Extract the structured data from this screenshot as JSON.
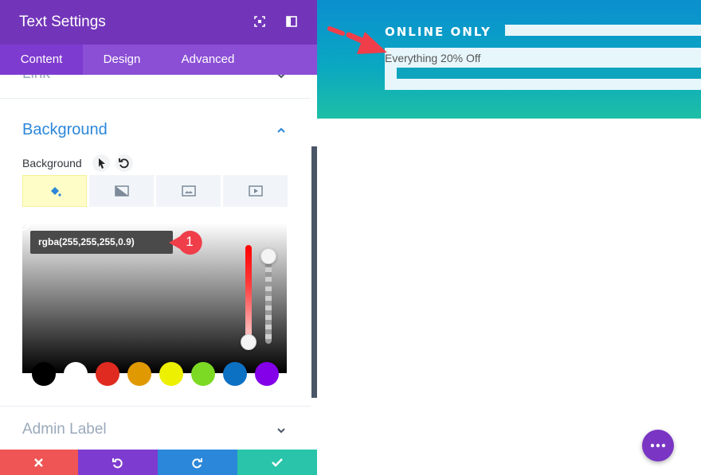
{
  "panel": {
    "title": "Text Settings",
    "header_icons": [
      "expand-icon",
      "sidebar-icon"
    ],
    "tabs": [
      {
        "label": "Content",
        "active": true
      },
      {
        "label": "Design",
        "active": false
      },
      {
        "label": "Advanced",
        "active": false
      }
    ],
    "collapsed_section_above": "Link",
    "background_section": {
      "title": "Background",
      "label": "Background",
      "type_tabs": [
        "paint-bucket-icon",
        "gradient-icon",
        "image-icon",
        "video-icon"
      ],
      "active_type_tab": "paint-bucket-icon",
      "color_value": "rgba(255,255,255,0.9)",
      "annotation_number": "1",
      "swatches": [
        "#000000",
        "#ffffff",
        "#e02b20",
        "#e09900",
        "#edf000",
        "#7cda24",
        "#0c71c3",
        "#8300e9"
      ]
    },
    "admin_section": {
      "title": "Admin Label"
    },
    "footer": {
      "buttons": [
        {
          "icon": "close-icon",
          "color": "#ef5555"
        },
        {
          "icon": "undo-icon",
          "color": "#7e3bd0"
        },
        {
          "icon": "redo-icon",
          "color": "#2b87da"
        },
        {
          "icon": "check-icon",
          "color": "#29c4a9"
        }
      ]
    }
  },
  "preview": {
    "heading": "ONLINE ONLY",
    "text": "Everything 20% Off"
  },
  "colors": {
    "header": "#7235b9",
    "tabs": "#8b4fd6",
    "accent_blue": "#2b87da",
    "annotation_red": "#ef3e4a"
  }
}
